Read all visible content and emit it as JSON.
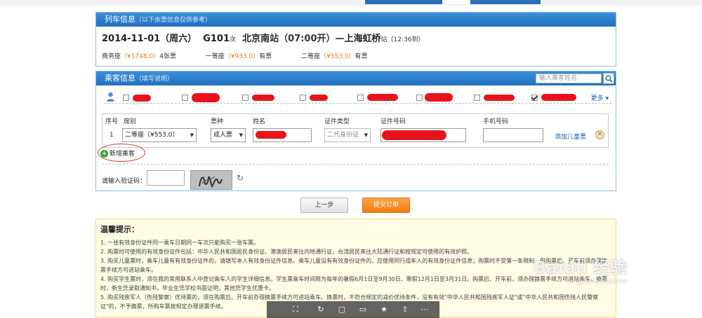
{
  "colors": {
    "header_blue": "#2a7ccc",
    "price_orange": "#e27b1c",
    "submit_orange": "#f5891e",
    "link_blue": "#1a5ca8",
    "redaction_red": "#e8131a"
  },
  "train_panel": {
    "title": "列车信息",
    "subtitle": "（以下余票信息仅供参考）",
    "date": "2014-11-01（周六）",
    "train_no": "G101",
    "train_suffix": "次",
    "from": "北京南",
    "from_suffix": "站（07:00开）—",
    "to": "上海虹桥",
    "to_suffix": "站",
    "duration": "（12:36到）",
    "seats": [
      {
        "class": "商务座",
        "price": "（¥1748.0）",
        "avail": "4张票"
      },
      {
        "class": "一等座",
        "price": "（¥933.0）",
        "avail": "有票"
      },
      {
        "class": "二等座",
        "price": "（¥553.0）",
        "avail": "有票"
      }
    ]
  },
  "passenger_panel": {
    "title": "乘客信息",
    "subtitle": "（填写说明）",
    "search_placeholder": "输入乘客姓名",
    "more_label": "更多 ▾",
    "columns": [
      "序号",
      "席别",
      "票种",
      "姓名",
      "证件类型",
      "证件号码",
      "手机号码"
    ],
    "row": {
      "index": "1",
      "seat": "二等座（¥553.0）",
      "ticket_type": "成人票",
      "id_type": "二代身份证",
      "add_child": "添加儿童票"
    },
    "add_passenger": "新增乘客",
    "captcha_label": "请输入验证码："
  },
  "buttons": {
    "prev": "上一步",
    "submit": "提交订单"
  },
  "tips": {
    "title": "温馨提示：",
    "items": [
      "1. 一张有效身份证件同一乘车日期同一车次只能购买一张车票。",
      "2. 购票时可使用的有效身份证件包括：中华人民共和国居民身份证、港澳居民来往内地通行证、台湾居民来往大陆通行证和按规定可使用的有效护照。",
      "3. 购买儿童票时，乘车儿童有有效身份证件的，请填写本人有效身份证件信息。乘车儿童没有有效身份证件的，应使用同行成年人的有效身份证件信息；购票时不受第一条限制，但购票后、开车前须办理换票手续方可进站乘车。",
      "4. 购买学生票时，须在我的常用联系人中登记乘车人的学生详细信息。学生票乘车时间限为每年的暑假6月1日至9月30日、寒假12月1日至3月31日。购票后、开车前，须办理换票手续方可进站乘车。换票时，新生凭录取通知书，毕业生凭学校书面证明，其他凭学生优惠卡。",
      "5. 购买残疾军人（伤残警察）优待票的，须在购票后、开车前办理换票手续方可进站乘车。换票时，不符合规定的减价优待条件，没有有效\"中华人民共和国残疾军人证\"或\"中华人民共和国伤残人民警察证\"的，不予换票，所购车票按规定办理退票手续。"
    ]
  },
  "watermark": {
    "text": "Baidu 经验",
    "sub": "jingyan.baidu.com"
  }
}
